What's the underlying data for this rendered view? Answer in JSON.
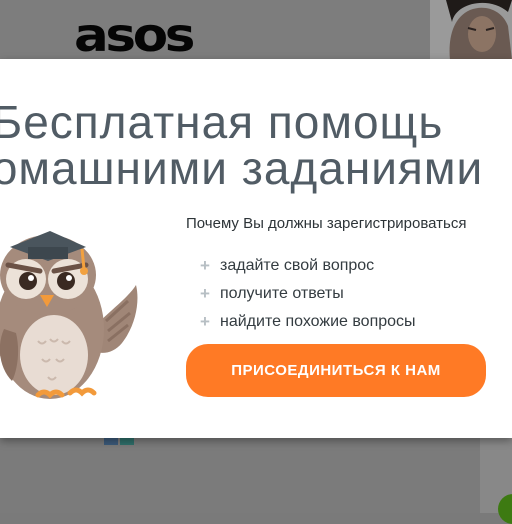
{
  "background": {
    "logo_text": "asos"
  },
  "modal": {
    "headline_line1": "Бесплатная помощь",
    "headline_line2": "домашними заданиями",
    "subtitle": "Почему Вы должны зарегистрироваться",
    "benefits": [
      {
        "icon": "plus-icon",
        "text": "задайте свой вопрос"
      },
      {
        "icon": "plus-icon",
        "text": "получите ответы"
      },
      {
        "icon": "plus-icon",
        "text": "найдите похожие вопросы"
      }
    ],
    "cta_label": "ПРИСОЕДИНИТЬСЯ К НАМ"
  },
  "colors": {
    "accent": "#ff7a25",
    "headline": "#515c65",
    "overlay": "#7a7a7a"
  }
}
